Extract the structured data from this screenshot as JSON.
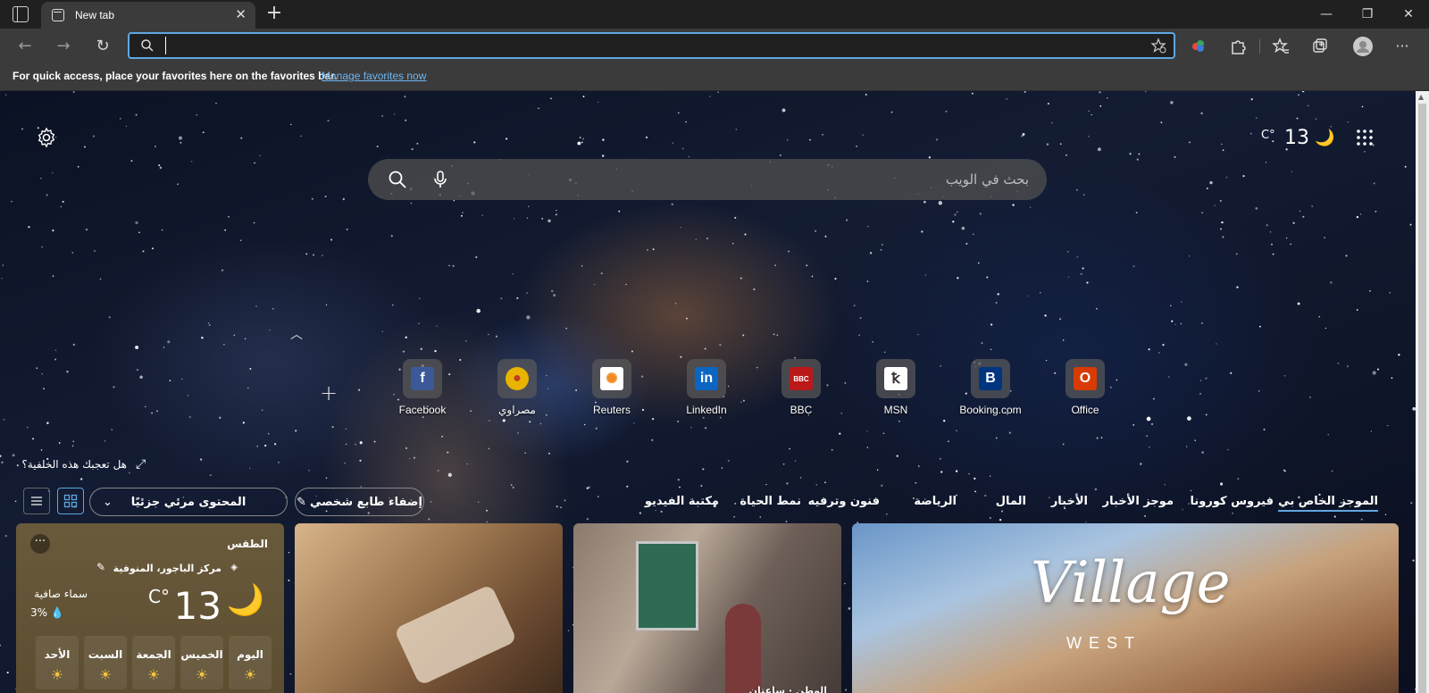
{
  "browser": {
    "tab_title": "New tab",
    "address_value": "",
    "favorites_bar_message": "For quick access, place your favorites here on the favorites bar.",
    "favorites_bar_link": "Manage favorites now"
  },
  "ntp": {
    "weather_unit": "C°",
    "weather_temp": "13",
    "search_placeholder": "بحث في الويب",
    "top_sites": [
      {
        "label": "Facebook",
        "icon": "facebook-icon"
      },
      {
        "label": "مصراوي",
        "icon": "masrawy-icon"
      },
      {
        "label": "Reuters",
        "icon": "reuters-icon"
      },
      {
        "label": "LinkedIn",
        "icon": "linkedin-icon"
      },
      {
        "label": "BBC",
        "icon": "bbc-icon"
      },
      {
        "label": "MSN",
        "icon": "msn-icon"
      },
      {
        "label": "Booking.com",
        "icon": "booking-icon"
      },
      {
        "label": "Office",
        "icon": "office-icon"
      }
    ],
    "background_prompt": "هل تعجبك هذه الخلفية؟",
    "feed": {
      "personalize_label": "إضفاء طابع شخصي",
      "content_visibility_label": "المحتوى مرئي جزئيًا",
      "tabs": [
        "الموجز الخاص بي",
        "فيروس كورونا",
        "موجز الأخبار",
        "الأخبار",
        "المال",
        "الرياضة",
        "فنون وترفيه",
        "نمط الحياة",
        "مكتبة الفيديو"
      ]
    },
    "weather_card": {
      "title": "الطقس",
      "more": "···",
      "location": "مركز الباجور، المنوفية",
      "temp": "13",
      "unit": "C°",
      "condition": "سماء صافية",
      "humidity": "3%",
      "days": [
        "اليوم",
        "الخميس",
        "الجمعة",
        "السبت",
        "الأحد"
      ]
    },
    "news_source": "الوطن · ساعتان",
    "ad_title": "Village",
    "ad_subtitle": "WEST"
  },
  "colors": {
    "accent": "#5fa7e0",
    "chrome_dark": "#202020",
    "toolbar": "#3b3b3b"
  }
}
